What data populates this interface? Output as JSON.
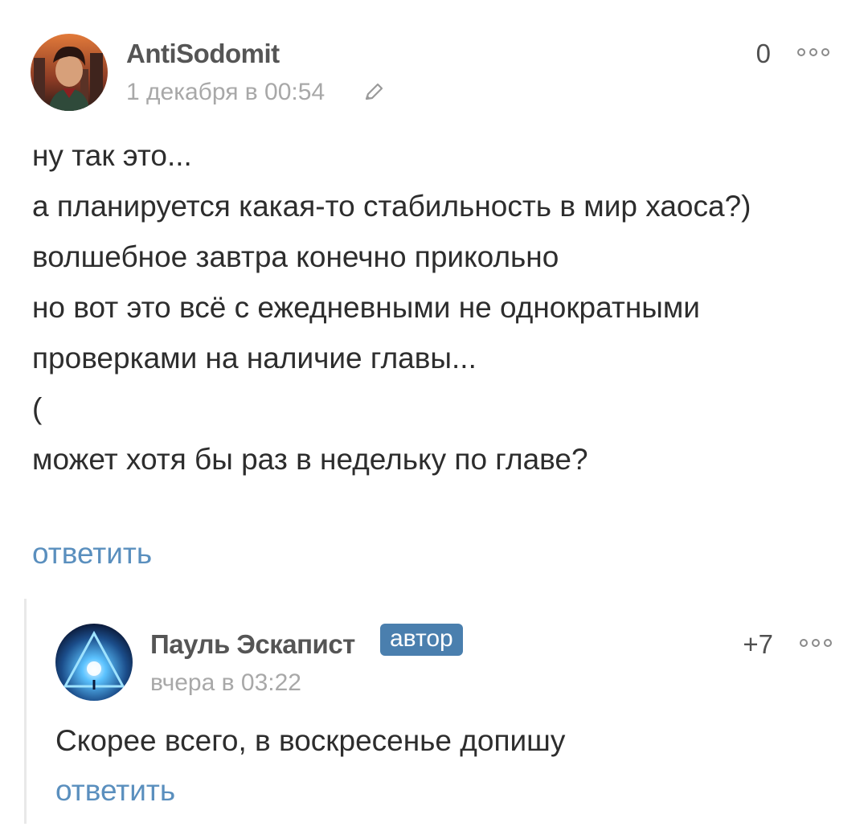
{
  "comments": [
    {
      "author": "AntiSodomit",
      "time": "1 декабря в 00:54",
      "rating": "0",
      "text": "ну так это...\nа планируется какая-то стабильность в мир хаоса?)\nволшебное завтра конечно прикольно\nно вот это всё с ежедневными не однократными проверками на наличие главы...\n(\nможет хотя бы раз в недельку по главе?",
      "reply": "ответить",
      "icons": {
        "avatar": "avatar-icon",
        "edit": "pencil-icon",
        "more": "more-options-icon"
      }
    },
    {
      "author": "Пауль Эскапист",
      "badge": "автор",
      "time": "вчера в 03:22",
      "rating": "+7",
      "text": "Скорее всего, в воскресенье допишу",
      "reply": "ответить",
      "icons": {
        "avatar": "avatar-icon",
        "more": "more-options-icon"
      }
    }
  ],
  "colors": {
    "link": "#5a8fbe",
    "badge": "#4a7fae",
    "meta": "#a8a8a8",
    "thread_line": "#e9e9e9"
  }
}
